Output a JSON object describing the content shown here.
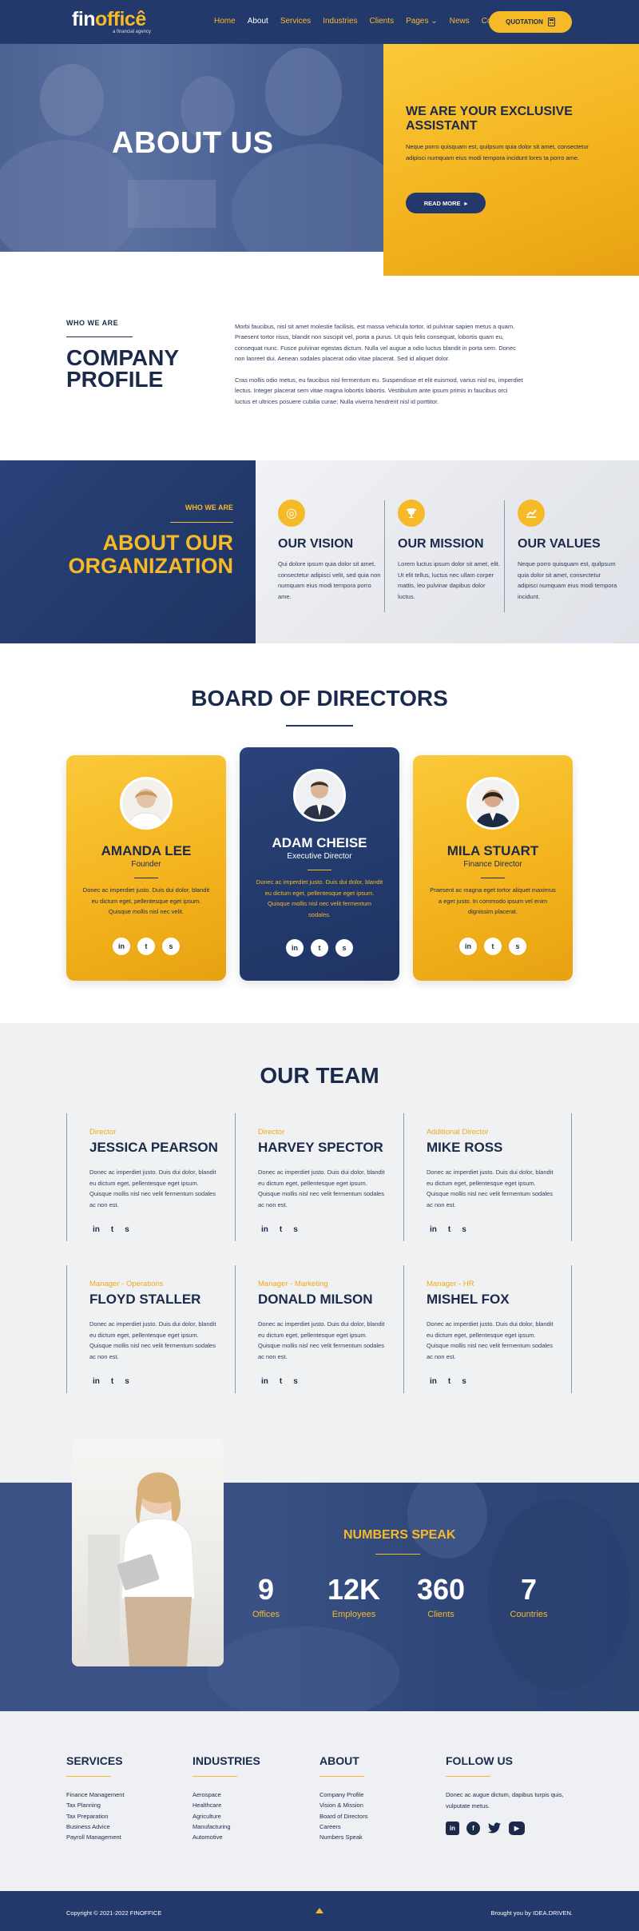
{
  "header": {
    "logo_prefix": "fin",
    "logo_suffix": "officê",
    "logo_tagline": "a financial agency",
    "nav": [
      "Home",
      "About",
      "Services",
      "Industries",
      "Clients",
      "Pages ⌄",
      "News",
      "Contact"
    ],
    "active_nav": "About",
    "quote_label": "QUOTATION"
  },
  "hero": {
    "title": "ABOUT US",
    "card_title": "WE ARE YOUR EXCLUSIVE ASSISTANT",
    "card_text": "Neque porro quisquam est, quilpsum quia dolor sit amet, consectetur adipisci numquam eius modi tempora incidunt lores ta porro ame.",
    "read_more": "READ MORE"
  },
  "profile": {
    "eyebrow": "WHO WE ARE",
    "title": "COMPANY PROFILE",
    "p1": "Morbi faucibus, nisl sit amet molestie facilisis, est massa vehicula tortor, id pulvinar sapien metus a quam. Praesent tortor risus, blandit non suscipit vel, porta a purus. Ut quis felis consequat, lobortis quam eu, consequat nunc. Fusce pulvinar egestas dictum. Nulla vel augue a odio luctus blandit in porta sem. Donec non laoreet dui. Aenean sodales placerat odio vitae placerat. Sed id aliquet dolor.",
    "p2": "Cras mollis odio metus, eu faucibus nisl fermentum eu. Suspendisse et elit euismod, varius nisl eu, imperdiet lectus. Integer placerat sem vitae magna lobortis lobortis. Vestibulum ante ipsum primis in faucibus orci luctus et ultrices posuere cubilia curae; Nulla viverra hendrerit nisl id porttitor."
  },
  "organization": {
    "eyebrow": "WHO WE ARE",
    "title": "ABOUT OUR ORGANIZATION",
    "columns": [
      {
        "icon": "target-icon",
        "title": "OUR VISION",
        "text": "Qui dolore ipsum quia dolor sit amet, consectetur adipisci velit, sed quia non numquam eius modi tempora porro ame."
      },
      {
        "icon": "trophy-icon",
        "title": "OUR MISSION",
        "text": "Lorem luctus ipsum dolor sit amet, elit. Ut elit tellus, luctus nec ullam corper mattis, leo pulvinar dapibus dolor luctus."
      },
      {
        "icon": "growth-chart-icon",
        "title": "OUR VALUES",
        "text": "Neque porro quisquam est, quilpsum quia dolor sit amet, consectetur adipisci numquam eius modi tempora incidunt."
      }
    ]
  },
  "board": {
    "title": "BOARD OF DIRECTORS",
    "members": [
      {
        "name": "AMANDA LEE",
        "role": "Founder",
        "text": "Donec ac imperdiet justo. Duis dui dolor, blandit eu dictum eget, pellentesque eget ipsum. Quisque mollis nisl nec velit."
      },
      {
        "name": "ADAM CHEISE",
        "role": "Executive Director",
        "text": "Donec ac imperdiet justo. Duis dui dolor, blandit eu dictum eget, pellentesque eget ipsum. Quisque mollis nisl nec velit fermentum sodales."
      },
      {
        "name": "MILA STUART",
        "role": "Finance Director",
        "text": "Praesent ac magna eget tortor aliquet maximus a eget justo. In commodo ipsum vel enim dignissim placerat."
      }
    ],
    "social": [
      "in",
      "t",
      "s"
    ]
  },
  "team": {
    "title": "OUR TEAM",
    "members": [
      {
        "role": "Director",
        "name": "JESSICA PEARSON"
      },
      {
        "role": "Director",
        "name": "HARVEY SPECTOR"
      },
      {
        "role": "Additional Director",
        "name": "MIKE ROSS"
      },
      {
        "role": "Manager - Operations",
        "name": "FLOYD STALLER"
      },
      {
        "role": "Manager - Marketing",
        "name": "DONALD MILSON"
      },
      {
        "role": "Manager - HR",
        "name": "MISHEL FOX"
      }
    ],
    "bio": "Donec ac imperdiet justo. Duis dui dolor, blandit eu dictum eget, pellentesque eget ipsum. Quisque mollis nisl nec velit fermentum sodales ac non est.",
    "social": [
      "in",
      "t",
      "s"
    ]
  },
  "numbers": {
    "title": "NUMBERS SPEAK",
    "stats": [
      {
        "value": "9",
        "label": "Offices"
      },
      {
        "value": "12K",
        "label": "Employees"
      },
      {
        "value": "360",
        "label": "Clients"
      },
      {
        "value": "7",
        "label": "Countries"
      }
    ]
  },
  "footer": {
    "services": {
      "title": "SERVICES",
      "items": [
        "Finance Management",
        "Tax Planning",
        "Tax Preparation",
        "Business Advice",
        "Payroll Management"
      ]
    },
    "industries": {
      "title": "INDUSTRIES",
      "items": [
        "Aerospace",
        "Healthcare",
        "Agriculture",
        "Manufacturing",
        "Automotive"
      ]
    },
    "about": {
      "title": "ABOUT",
      "items": [
        "Company Profile",
        "Vision & Mission",
        "Board of Directors",
        "Careers",
        "Numbers Speak"
      ]
    },
    "follow": {
      "title": "FOLLOW US",
      "text": "Donec ac augue dictum, dapibus turpis quis, vulputate metus."
    },
    "copyright": "Copyright © 2021-2022 FINOFFICE",
    "brought_by": "Brought you by IDEA.DRIVEN."
  },
  "colors": {
    "navy": "#24396b",
    "gold": "#f6b928",
    "light_gray": "#f0f1f3"
  }
}
